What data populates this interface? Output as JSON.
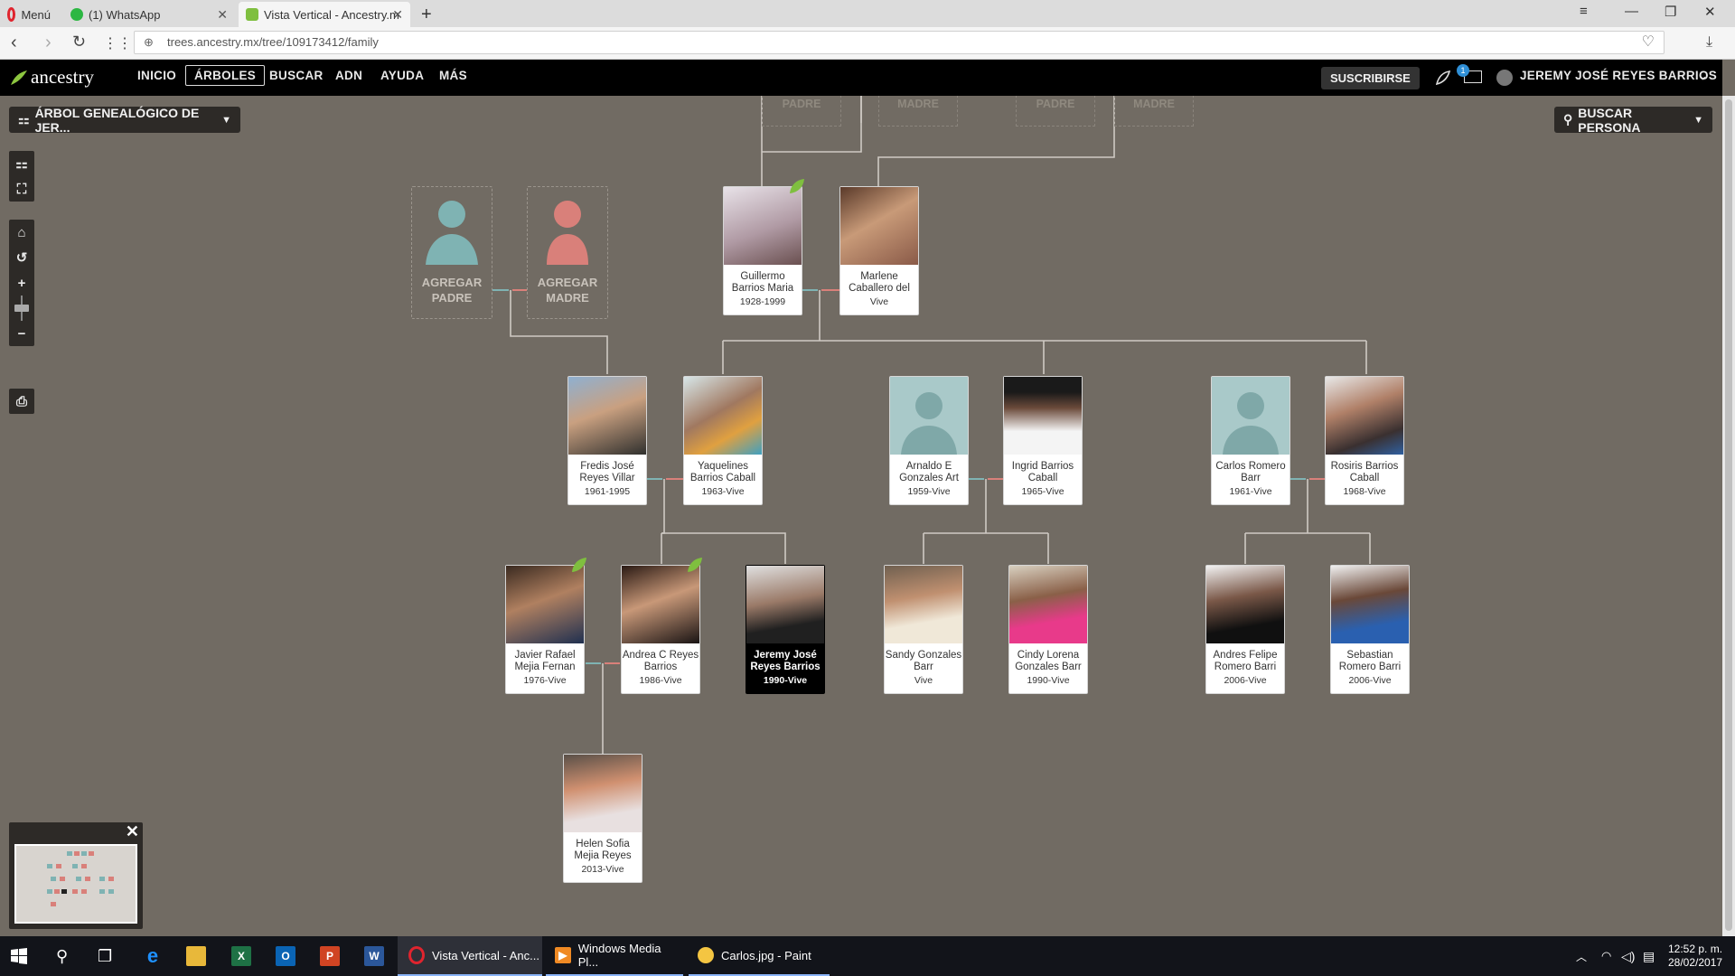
{
  "browser": {
    "tabs": [
      {
        "label": "Menú"
      },
      {
        "label": "(1) WhatsApp"
      },
      {
        "label": "Vista Vertical - Ancestry.m"
      }
    ],
    "url": "trees.ancestry.mx/tree/109173412/family"
  },
  "app": {
    "logo": "ancestry",
    "nav": [
      "INICIO",
      "ÁRBOLES",
      "BUSCAR",
      "ADN",
      "AYUDA",
      "MÁS"
    ],
    "subscribe": "SUSCRIBIRSE",
    "messages_badge": "1",
    "user": "JEREMY JOSÉ REYES BARRIOS",
    "tree_selector": "ÁRBOL GENEALÓGICO DE JER...",
    "search_person": "BUSCAR PERSONA"
  },
  "ghosts": [
    "PADRE",
    "MADRE",
    "PADRE",
    "MADRE"
  ],
  "placeholders": {
    "father": "AGREGAR PADRE",
    "mother": "AGREGAR MADRE"
  },
  "people": {
    "guillermo": {
      "name": "Guillermo Barrios Maria",
      "dates": "1928-1999"
    },
    "marlene": {
      "name": "Marlene Caballero del",
      "dates": "Vive"
    },
    "fredis": {
      "name": "Fredis José Reyes Villar",
      "dates": "1961-1995"
    },
    "yaquelines": {
      "name": "Yaquelines Barrios Caball",
      "dates": "1963-Vive"
    },
    "arnaldo": {
      "name": "Arnaldo E Gonzales Art",
      "dates": "1959-Vive"
    },
    "ingrid": {
      "name": "Ingrid Barrios Caball",
      "dates": "1965-Vive"
    },
    "carlos": {
      "name": "Carlos Romero Barr",
      "dates": "1961-Vive"
    },
    "rosiris": {
      "name": "Rosiris Barrios Caball",
      "dates": "1968-Vive"
    },
    "javier": {
      "name": "Javier Rafael Mejia Fernan",
      "dates": "1976-Vive"
    },
    "andrea": {
      "name": "Andrea C Reyes Barrios",
      "dates": "1986-Vive"
    },
    "jeremy": {
      "name": "Jeremy José Reyes Barrios",
      "dates": "1990-Vive"
    },
    "sandy": {
      "name": "Sandy Gonzales Barr",
      "dates": "Vive"
    },
    "cindy": {
      "name": "Cindy Lorena Gonzales Barr",
      "dates": "1990-Vive"
    },
    "andres": {
      "name": "Andres Felipe Romero Barri",
      "dates": "2006-Vive"
    },
    "sebastian": {
      "name": "Sebastian Romero Barri",
      "dates": "2006-Vive"
    },
    "helen": {
      "name": "Helen Sofia Mejia Reyes",
      "dates": "2013-Vive"
    }
  },
  "taskbar": {
    "items": [
      "Vista Vertical - Anc...",
      "Windows Media Pl...",
      "Carlos.jpg - Paint"
    ],
    "time": "12:52 p. m.",
    "date": "28/02/2017"
  },
  "colors": {
    "canvas": "#716b63",
    "male": "#7fb3b3",
    "female": "#d9807a",
    "leaf": "#7fbf3f"
  }
}
